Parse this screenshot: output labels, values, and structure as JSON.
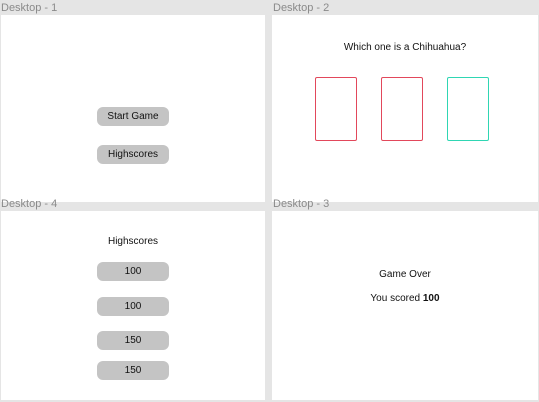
{
  "artboards": {
    "desktop1": {
      "label": "Desktop - 1",
      "start_button": "Start Game",
      "highscores_button": "Highscores"
    },
    "desktop2": {
      "label": "Desktop - 2",
      "question": "Which one is a Chihuahua?",
      "cards": [
        {
          "state": "incorrect",
          "color": "#e2485b"
        },
        {
          "state": "incorrect",
          "color": "#e2485b"
        },
        {
          "state": "correct",
          "color": "#2fd6b3"
        }
      ]
    },
    "desktop4": {
      "label": "Desktop - 4",
      "title": "Highscores",
      "scores": [
        "100",
        "100",
        "150",
        "150"
      ]
    },
    "desktop3": {
      "label": "Desktop - 3",
      "title": "Game Over",
      "score_prefix": "You scored ",
      "score_value": "100"
    }
  }
}
